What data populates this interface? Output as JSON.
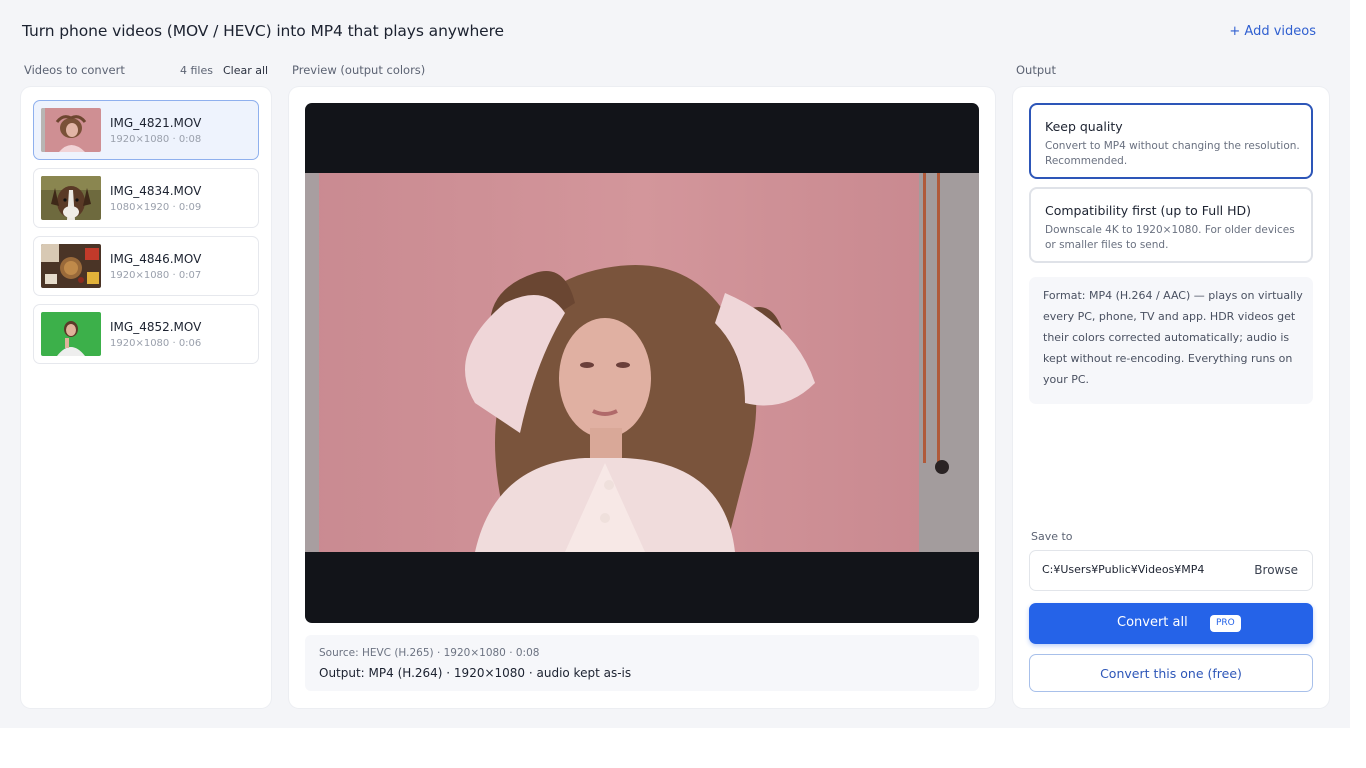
{
  "header": {
    "title": "Turn phone videos (MOV / HEVC) into MP4 that plays anywhere",
    "add_videos_label": "+ Add videos"
  },
  "files_panel": {
    "title": "Videos to convert",
    "count": "4 files",
    "clear_all_label": "Clear all",
    "items": [
      {
        "name": "IMG_4821.MOV",
        "meta": "1920×1080 · 0:08",
        "selected": true
      },
      {
        "name": "IMG_4834.MOV",
        "meta": "1080×1920 · 0:09",
        "selected": false
      },
      {
        "name": "IMG_4846.MOV",
        "meta": "1920×1080 · 0:07",
        "selected": false
      },
      {
        "name": "IMG_4852.MOV",
        "meta": "1920×1080 · 0:06",
        "selected": false
      }
    ]
  },
  "preview": {
    "title": "Preview (output colors)",
    "source": "Source: HEVC (H.265) · 1920×1080 · 0:08",
    "output": "Output: MP4 (H.264) · 1920×1080 · audio kept as-is"
  },
  "output_panel": {
    "title": "Output",
    "options": [
      {
        "title": "Keep quality",
        "desc": "Convert to MP4 without changing the resolution. Recommended.",
        "selected": true
      },
      {
        "title": "Compatibility first (up to Full HD)",
        "desc": "Downscale 4K to 1920×1080. For older devices or smaller files to send.",
        "selected": false
      }
    ],
    "format_note": "Format: MP4 (H.264 / AAC) — plays on virtually every PC, phone, TV and app. HDR videos get their colors corrected automatically; audio is kept without re-encoding. Everything runs on your PC.",
    "save_to_label": "Save to",
    "save_path": "C:¥Users¥Public¥Videos¥MP4",
    "browse_label": "Browse",
    "convert_all_label": "Convert all",
    "pro_badge": "PRO",
    "convert_one_label": "Convert this one (free)"
  },
  "colors": {
    "accent": "#2563e8",
    "selected_border": "#2d56b8",
    "background": "#f4f5f8"
  }
}
